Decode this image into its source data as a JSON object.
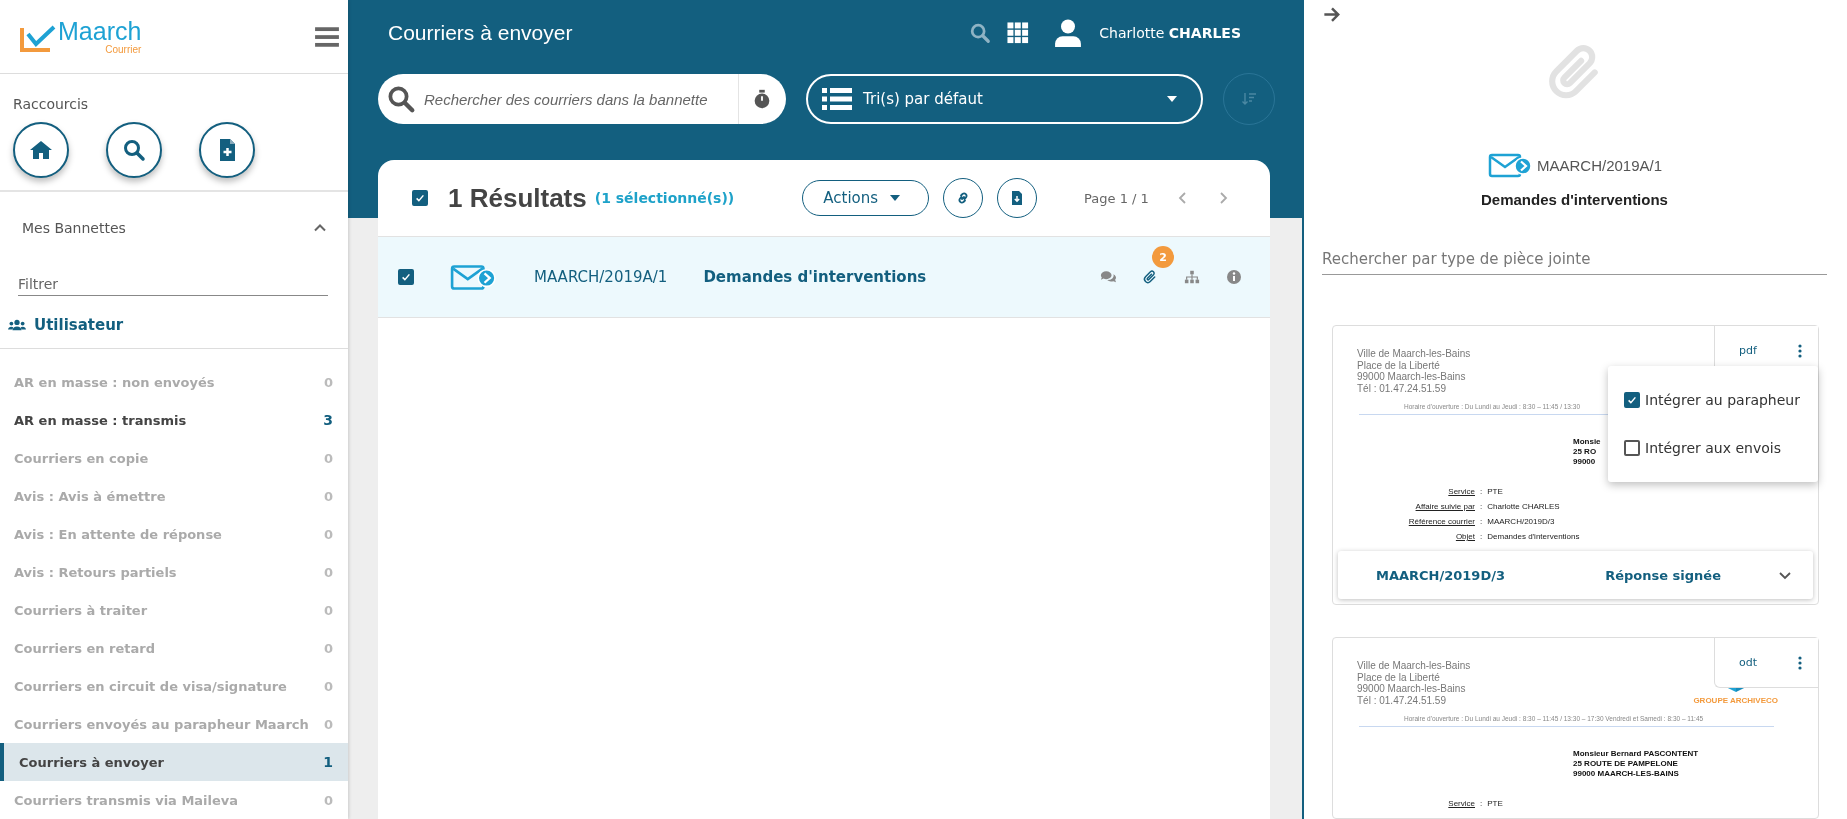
{
  "sidebar": {
    "logo": {
      "name": "Maarch",
      "subtitle": "Courrier"
    },
    "shortcuts_title": "Raccourcis",
    "baskets": {
      "title": "Mes Bannettes",
      "expanded": true
    },
    "filter": {
      "placeholder": "Filtrer"
    },
    "group": "Utilisateur",
    "items": [
      {
        "label": "AR en masse : non envoyés",
        "count": "0",
        "has_mail": false,
        "selected": false
      },
      {
        "label": "AR en masse : transmis",
        "count": "3",
        "has_mail": true,
        "selected": false
      },
      {
        "label": "Courriers en copie",
        "count": "0",
        "has_mail": false,
        "selected": false
      },
      {
        "label": "Avis : Avis à émettre",
        "count": "0",
        "has_mail": false,
        "selected": false
      },
      {
        "label": "Avis : En attente de réponse",
        "count": "0",
        "has_mail": false,
        "selected": false
      },
      {
        "label": "Avis : Retours partiels",
        "count": "0",
        "has_mail": false,
        "selected": false
      },
      {
        "label": "Courriers à traiter",
        "count": "0",
        "has_mail": false,
        "selected": false
      },
      {
        "label": "Courriers en retard",
        "count": "0",
        "has_mail": false,
        "selected": false
      },
      {
        "label": "Courriers en circuit de visa/signature",
        "count": "0",
        "has_mail": false,
        "selected": false
      },
      {
        "label": "Courriers envoyés au parapheur Maarch",
        "count": "0",
        "has_mail": false,
        "selected": false
      },
      {
        "label": "Courriers à envoyer",
        "count": "1",
        "has_mail": true,
        "selected": true
      },
      {
        "label": "Courriers transmis via Maileva",
        "count": "0",
        "has_mail": false,
        "selected": false
      }
    ]
  },
  "header": {
    "title": "Courriers à envoyer",
    "user": "Charlotte **CHARLES**",
    "search": {
      "placeholder": "Rechercher des courriers dans la bannette"
    },
    "sort": "Tri(s) par défaut"
  },
  "list": {
    "all_checked": true,
    "results": "1 Résultats",
    "selection": "(1 sélectionné(s))",
    "actions": "Actions",
    "page": "Page 1 / 1",
    "rows": [
      {
        "checked": true,
        "reference": "MAARCH/2019A/1",
        "subject": "Demandes d'interventions",
        "attachments": "2"
      }
    ]
  },
  "panel": {
    "reference": "MAARCH/2019A/1",
    "subject": "Demandes d'interventions",
    "search": {
      "placeholder": "Rechercher par type de pièce jointe"
    },
    "attachments": [
      {
        "format": "pdf",
        "reference": "MAARCH/2019D/3",
        "type": "Réponse signée",
        "menu": [
          {
            "label": "Intégrer au parapheur",
            "checked": true
          },
          {
            "label": "Intégrer aux envois",
            "checked": false
          }
        ],
        "document": {
          "sender": [
            "Ville de Maarch-les-Bains",
            "Place de la Liberté",
            "99000 Maarch-les-Bains",
            "Tél : 01.47.24.51.59"
          ],
          "hours": "Horaire d'ouverture : Du Lundi au Jeudi : 8:30 – 11:45 / 13:30",
          "recipient": [
            "Monsie",
            "25 RO",
            "99000"
          ],
          "fields": [
            {
              "label": "Service",
              "separator": ":",
              "value": "PTE"
            },
            {
              "label": "Affaire suivie par",
              "separator": ":",
              "value": "Charlotte CHARLES"
            },
            {
              "label": "Référence courrier",
              "separator": ":",
              "value": "MAARCH/2019D/3"
            },
            {
              "label": "Objet",
              "separator": ":",
              "value": "Demandes d'interventions"
            }
          ]
        }
      },
      {
        "format": "odt",
        "document": {
          "logo_caption": "GROUPE ARCHIVECO",
          "sender": [
            "Ville de Maarch-les-Bains",
            "Place de la Liberté",
            "99000 Maarch-les-Bains",
            "Tél : 01.47.24.51.59"
          ],
          "hours": "Horaire d'ouverture : Du Lundi au Jeudi : 8:30 – 11:45 / 13:30 – 17:30 Vendredi et Samedi : 8:30 – 11:45",
          "recipient": [
            "Monsieur Bernard PASCONTENT",
            "25 ROUTE DE PAMPELONE",
            "99000 MAARCH-LES-BAINS"
          ],
          "fields": [
            {
              "label": "Service",
              "separator": ":",
              "value": "PTE"
            }
          ]
        }
      }
    ]
  }
}
